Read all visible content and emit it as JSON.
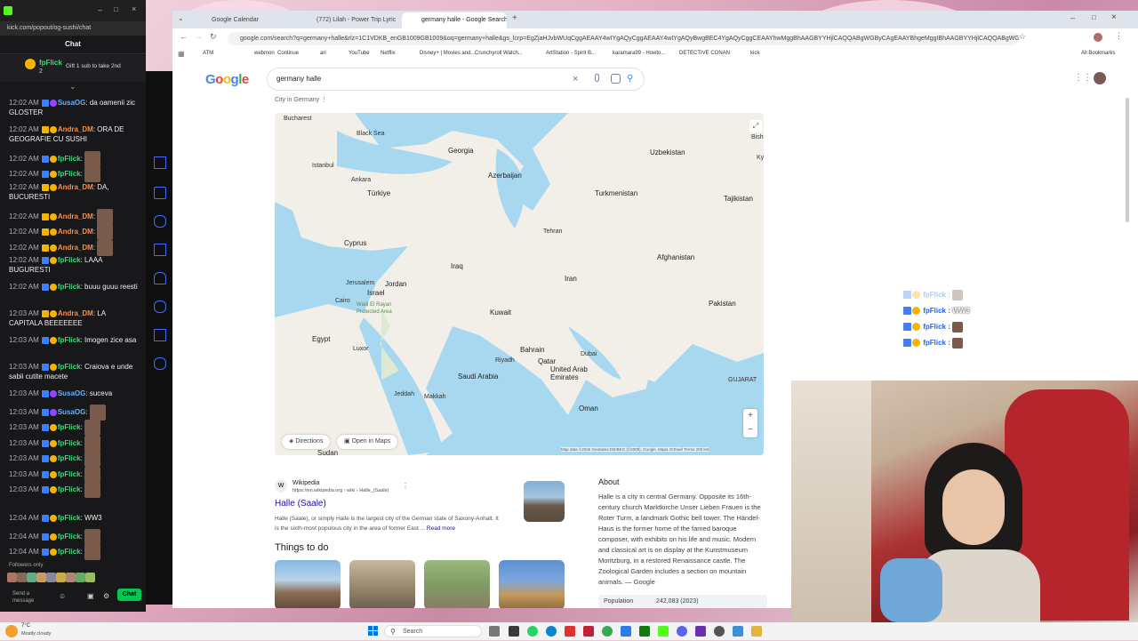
{
  "chat": {
    "url": "kick.com/popout/og-sushi/chat",
    "header": "Chat",
    "pinned_user": "fpFlick",
    "pinned_count": "2",
    "pinned_text": "Gift 1 sub to take 2nd",
    "messages": [
      {
        "time": "12:02 AM",
        "user": "SusaOG",
        "text": "da oamenii zic GLOSTER"
      },
      {
        "time": "12:02 AM",
        "user": "Andra_DM",
        "text": "ORA DE GEOGRAFIE CU SUSHI"
      },
      {
        "time": "12:02 AM",
        "user": "fpFlick",
        "text": ""
      },
      {
        "time": "12:02 AM",
        "user": "fpFlick",
        "text": ""
      },
      {
        "time": "12:02 AM",
        "user": "Andra_DM",
        "text": "DA, BUCURESTI"
      },
      {
        "time": "12:02 AM",
        "user": "Andra_DM",
        "text": ""
      },
      {
        "time": "12:02 AM",
        "user": "Andra_DM",
        "text": ""
      },
      {
        "time": "12:02 AM",
        "user": "Andra_DM",
        "text": ""
      },
      {
        "time": "12:02 AM",
        "user": "fpFlick",
        "text": "LAAA BUGURESTI"
      },
      {
        "time": "12:02 AM",
        "user": "fpFlick",
        "text": "buuu guuu reesti"
      },
      {
        "time": "12:03 AM",
        "user": "Andra_DM",
        "text": "LA CAPITALA BEEEEEEE"
      },
      {
        "time": "12:03 AM",
        "user": "fpFlick",
        "text": "Imogen zice asa"
      },
      {
        "time": "12:03 AM",
        "user": "fpFlick",
        "text": "Craiova e unde sabii cutite macete"
      },
      {
        "time": "12:03 AM",
        "user": "SusaOG",
        "text": "suceva"
      },
      {
        "time": "12:03 AM",
        "user": "SusaOG",
        "text": ""
      },
      {
        "time": "12:03 AM",
        "user": "fpFlick",
        "text": ""
      },
      {
        "time": "12:03 AM",
        "user": "fpFlick",
        "text": ""
      },
      {
        "time": "12:03 AM",
        "user": "fpFlick",
        "text": ""
      },
      {
        "time": "12:03 AM",
        "user": "fpFlick",
        "text": ""
      },
      {
        "time": "12:03 AM",
        "user": "fpFlick",
        "text": ""
      },
      {
        "time": "12:04 AM",
        "user": "fpFlick",
        "text": "WW3"
      },
      {
        "time": "12:04 AM",
        "user": "fpFlick",
        "text": ""
      },
      {
        "time": "12:04 AM",
        "user": "fpFlick",
        "text": ""
      }
    ],
    "followers_only": "Followers only",
    "send_placeholder": "Send a message",
    "chat_button": "Chat"
  },
  "browser": {
    "tabs": [
      {
        "label": "Google Calendar"
      },
      {
        "label": "(772) Lilah - Power Trip Lyric"
      },
      {
        "label": "germany halle - Google Search"
      }
    ],
    "url": "google.com/search?q=germany+halle&rlz=1C1VDKB_enGB1009GB1009&oq=germany+halle&gs_lcrp=EgZjaHJvbWUqCggAEAAY4wIYgAQyCggAEAAY4wIYgAQyBwgBEC4YgAQyCggCEAAYhwMggBhAAGBYYHjlCAQQABgWGByCAgEAAYBhgeMggIBhAAGBYYHjlCAQQABgWGByCAgEAAYBhgeMggIBhAAGBYYHjlCAQQABgWGByCAgEAAYBhgeMggIBhAAGBYYHjl",
    "bookmarks": [
      "ATM",
      "webmon",
      "Continue",
      "ari",
      "YouTube",
      "Netflix",
      "Disney+ | Movies and...",
      "Crunchyroll Watch...",
      "ArtStation - Spirit B...",
      "karamara99 - Howto...",
      "DETECTIVE CONAN",
      "kick"
    ],
    "all_bookmarks": "All Bookmarks"
  },
  "google": {
    "logo": "Google",
    "query": "germany halle",
    "city_label": "City in Germany",
    "map_labels": [
      {
        "text": "Bucharest"
      },
      {
        "text": "Black Sea"
      },
      {
        "text": "Georgia"
      },
      {
        "text": "Istanbul"
      },
      {
        "text": "Ankara"
      },
      {
        "text": "Azerbaijan"
      },
      {
        "text": "Türkiye"
      },
      {
        "text": "Uzbekistan"
      },
      {
        "text": "Turkmenistan"
      },
      {
        "text": "Tajikistan"
      },
      {
        "text": "Cyprus"
      },
      {
        "text": "Tehran"
      },
      {
        "text": "Iraq"
      },
      {
        "text": "Afghanistan"
      },
      {
        "text": "Jerusalem"
      },
      {
        "text": "Jordan"
      },
      {
        "text": "Israel"
      },
      {
        "text": "Iran"
      },
      {
        "text": "Cairo"
      },
      {
        "text": "Kuwait"
      },
      {
        "text": "Pakistan"
      },
      {
        "text": "Wadi El Rayan Protected Area"
      },
      {
        "text": "Egypt"
      },
      {
        "text": "Bahrain"
      },
      {
        "text": "Qatar"
      },
      {
        "text": "Luxor"
      },
      {
        "text": "Riyadh"
      },
      {
        "text": "Dubai"
      },
      {
        "text": "United Arab Emirates"
      },
      {
        "text": "Saudi Arabia"
      },
      {
        "text": "Jeddah"
      },
      {
        "text": "Makkah"
      },
      {
        "text": "Oman"
      },
      {
        "text": "Sudan"
      },
      {
        "text": "GUJARAT"
      },
      {
        "text": "Bish"
      },
      {
        "text": "Ky"
      }
    ],
    "map_buttons": {
      "directions": "Directions",
      "open_in_maps": "Open in Maps",
      "zoom_in": "+",
      "zoom_out": "−"
    },
    "map_attribution": "Map data ©2026 Geobasis-DE/BKG (©2009), Google, Mapa GISrael",
    "map_terms": "Terms",
    "map_scale": "200 km",
    "wiki": {
      "source": "Wikipedia",
      "url": "https://en.wikipedia.org › wiki › Halle_(Saale)",
      "title": "Halle (Saale)",
      "snippet": "Halle (Saale), or simply Halle is the largest city of the German state of Saxony-Anhalt. It is the sixth-most populous city in the area of former East ...",
      "read_more": "Read more"
    },
    "about": {
      "heading": "About",
      "text": "Halle is a city in central Germany. Opposite its 16th-century church Marktkirche Unser Lieben Frauen is the Roter Turm, a landmark Gothic bell tower. The Händel-Haus is the former home of the famed baroque composer, with exhibits on his life and music. Modern and classical art is on display at the Kunstmuseum Moritzburg, in a restored Renaissance castle. The Zoological Garden includes a section on mountain animals.",
      "source": "— Google",
      "population_label": "Population",
      "population_value": "242,083 (2023)"
    },
    "things_to_do": "Things to do"
  },
  "overlay": {
    "lines": [
      {
        "user": "fpFlick",
        "text": ""
      },
      {
        "user": "fpFlick",
        "text": "WW3"
      },
      {
        "user": "fpFlick",
        "text": ""
      },
      {
        "user": "fpFlick",
        "text": ""
      }
    ]
  },
  "taskbar": {
    "weather_temp": "7°C",
    "weather_text": "Mostly cloudy",
    "search_placeholder": "Search"
  },
  "colors": {
    "chat_bg": "#18181b",
    "kick_green": "#00c853",
    "google_blue": "#1a0dab"
  }
}
